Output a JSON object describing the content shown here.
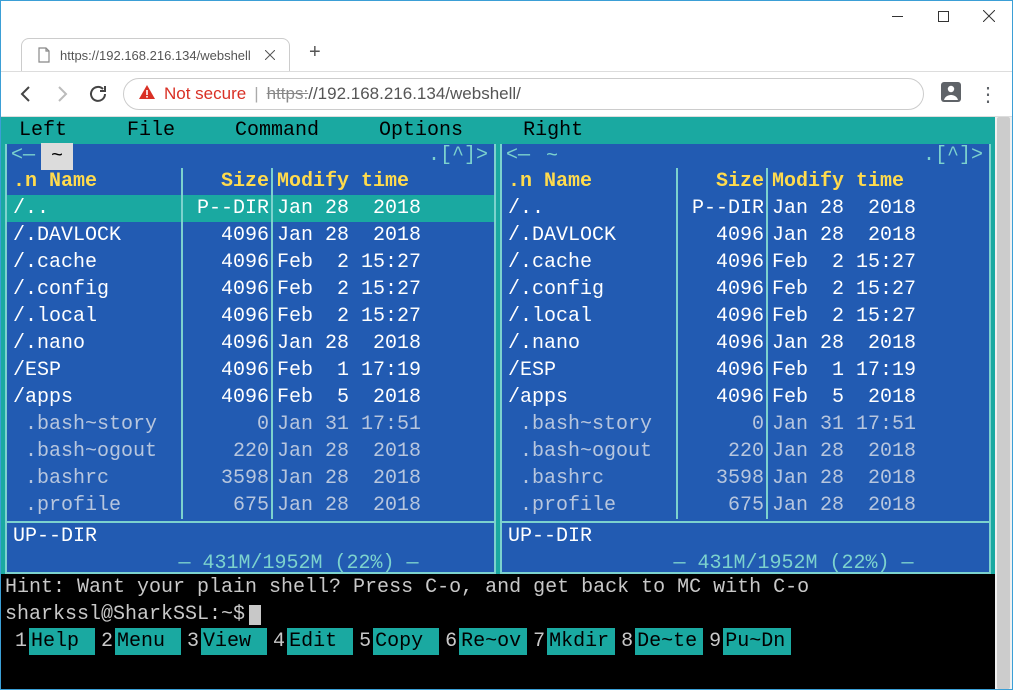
{
  "window": {
    "tab_title": "https://192.168.216.134/webshell"
  },
  "toolbar": {
    "not_secure": "Not secure",
    "url_proto": "https:",
    "url_rest": "//192.168.216.134/webshell/"
  },
  "mc_menu": [
    "Left",
    "File",
    "Command",
    "Options",
    "Right"
  ],
  "panel_top": {
    "left_sym": "<—",
    "tilde": "~",
    "right_sym": ".[^]>"
  },
  "columns": {
    "n": ".n",
    "name": "Name",
    "size": "Size",
    "modify": "Modify time"
  },
  "rows": [
    {
      "name": "/..",
      "size": "P--DIR",
      "mod": "Jan 28  2018",
      "sel": true,
      "gray": false
    },
    {
      "name": "/.DAVLOCK",
      "size": "4096",
      "mod": "Jan 28  2018",
      "sel": false,
      "gray": false
    },
    {
      "name": "/.cache",
      "size": "4096",
      "mod": "Feb  2 15:27",
      "sel": false,
      "gray": false
    },
    {
      "name": "/.config",
      "size": "4096",
      "mod": "Feb  2 15:27",
      "sel": false,
      "gray": false
    },
    {
      "name": "/.local",
      "size": "4096",
      "mod": "Feb  2 15:27",
      "sel": false,
      "gray": false
    },
    {
      "name": "/.nano",
      "size": "4096",
      "mod": "Jan 28  2018",
      "sel": false,
      "gray": false
    },
    {
      "name": "/ESP",
      "size": "4096",
      "mod": "Feb  1 17:19",
      "sel": false,
      "gray": false
    },
    {
      "name": "/apps",
      "size": "4096",
      "mod": "Feb  5  2018",
      "sel": false,
      "gray": false
    },
    {
      "name": " .bash~story",
      "size": "0",
      "mod": "Jan 31 17:51",
      "sel": false,
      "gray": true
    },
    {
      "name": " .bash~ogout",
      "size": "220",
      "mod": "Jan 28  2018",
      "sel": false,
      "gray": true
    },
    {
      "name": " .bashrc",
      "size": "3598",
      "mod": "Jan 28  2018",
      "sel": false,
      "gray": true
    },
    {
      "name": " .profile",
      "size": "675",
      "mod": "Jan 28  2018",
      "sel": false,
      "gray": true
    }
  ],
  "panel_status": "UP--DIR",
  "panel_disk": "431M/1952M (22%)",
  "shell": {
    "hint": "Hint: Want your plain shell? Press C-o, and get back to MC with C-o",
    "prompt": "sharkssl@SharkSSL:~$"
  },
  "fkeys": [
    {
      "n": "1",
      "l": "Help"
    },
    {
      "n": "2",
      "l": "Menu"
    },
    {
      "n": "3",
      "l": "View"
    },
    {
      "n": "4",
      "l": "Edit"
    },
    {
      "n": "5",
      "l": "Copy"
    },
    {
      "n": "6",
      "l": "Re~ov"
    },
    {
      "n": "7",
      "l": "Mkdir"
    },
    {
      "n": "8",
      "l": "De~te"
    },
    {
      "n": "9",
      "l": "Pu~Dn"
    }
  ]
}
